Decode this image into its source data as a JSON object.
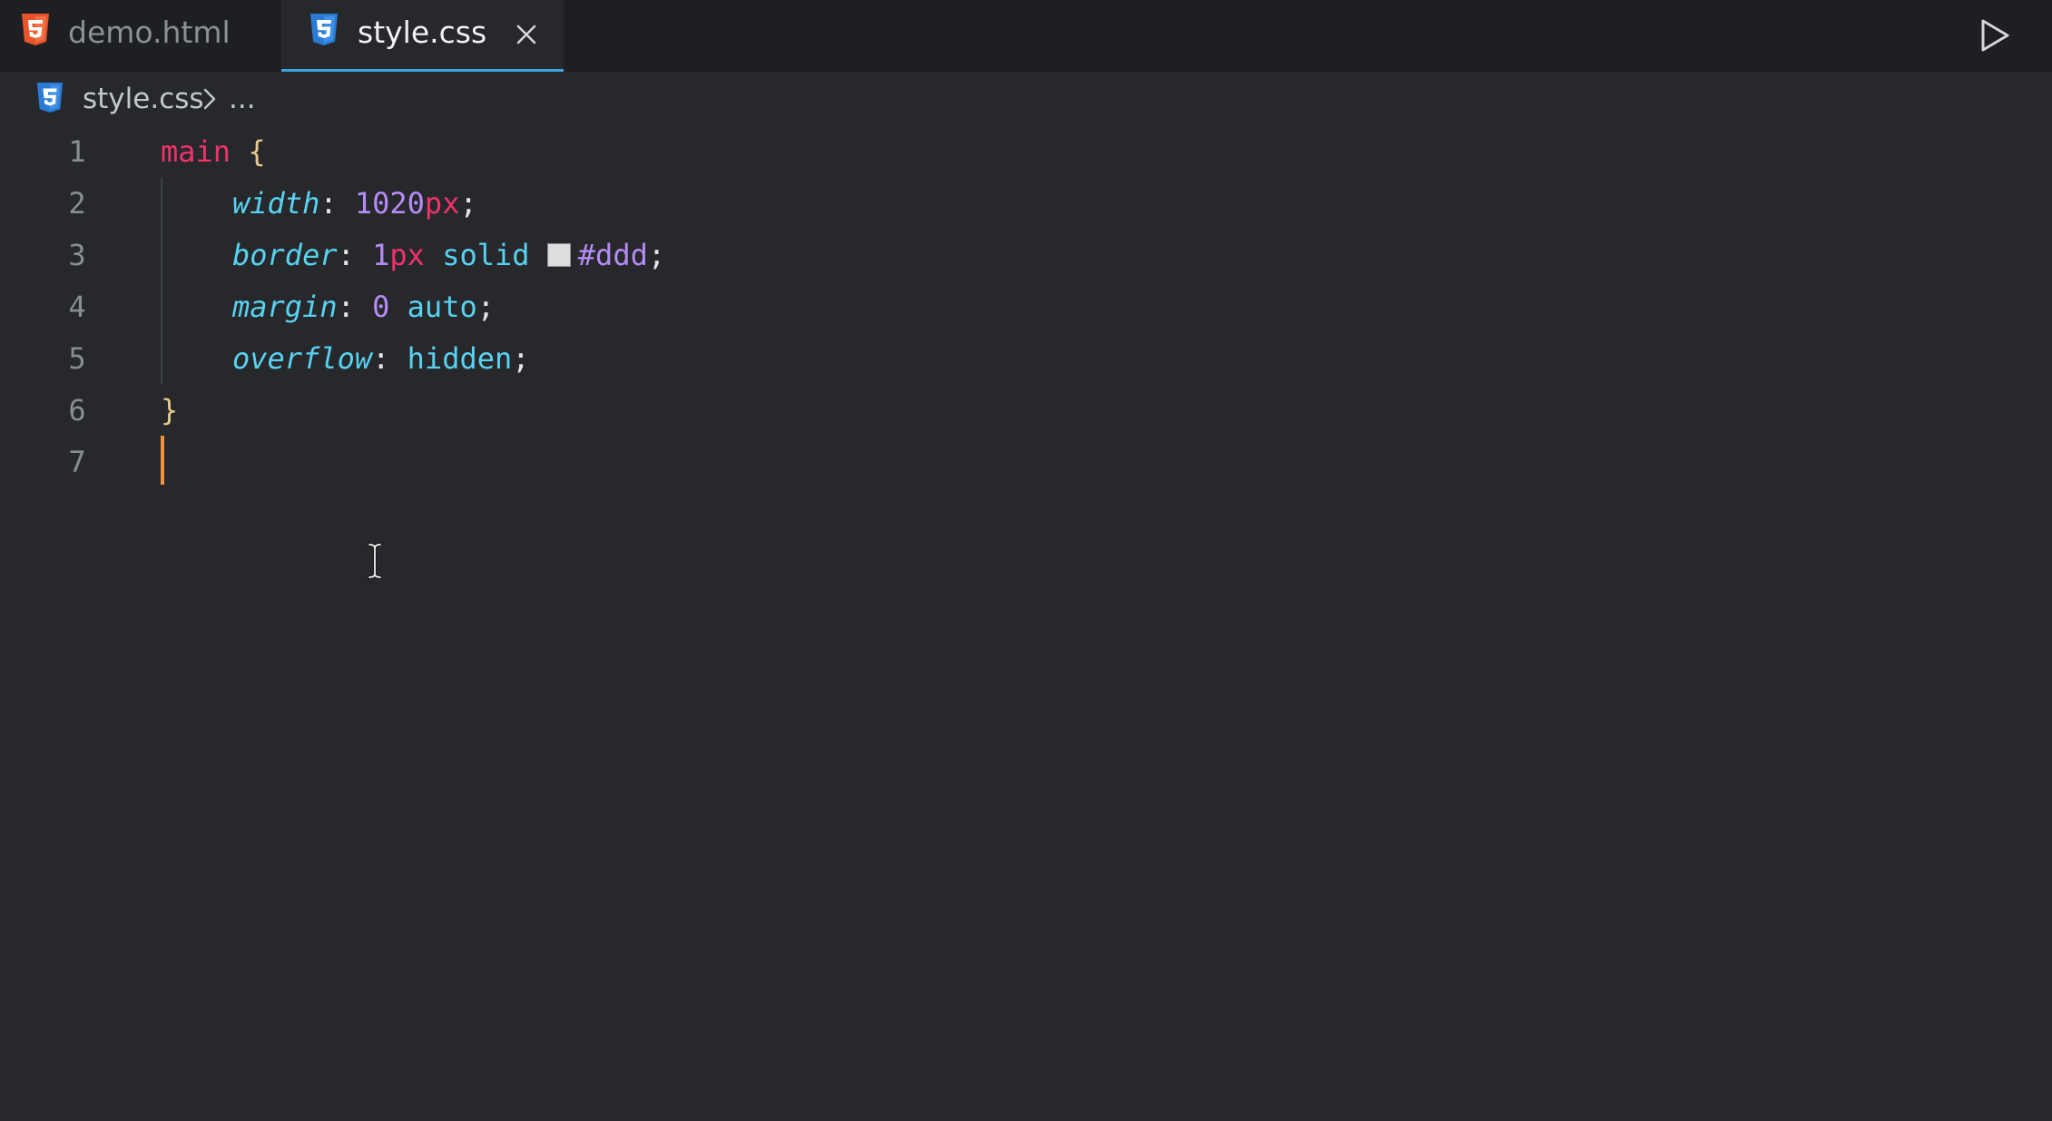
{
  "tabs": [
    {
      "label": "demo.html",
      "icon": "html5-icon",
      "active": false,
      "icon_color": "#e8552a"
    },
    {
      "label": "style.css",
      "icon": "css3-icon",
      "active": true,
      "icon_color": "#2a7bd4"
    }
  ],
  "breadcrumb": {
    "file": "style.css",
    "more": "..."
  },
  "editor": {
    "line_numbers": [
      "1",
      "2",
      "3",
      "4",
      "5",
      "6",
      "7"
    ],
    "lines": {
      "l1": {
        "selector": "main",
        "brace": "{"
      },
      "l2": {
        "prop": "width",
        "colon": ":",
        "num": "1020",
        "unit": "px",
        "semi": ";"
      },
      "l3": {
        "prop": "border",
        "colon": ":",
        "num": "1",
        "unit": "px",
        "kw": "solid",
        "hex": "#ddd",
        "semi": ";"
      },
      "l4": {
        "prop": "margin",
        "colon": ":",
        "num": "0",
        "kw": "auto",
        "semi": ";"
      },
      "l5": {
        "prop": "overflow",
        "colon": ":",
        "kw": "hidden",
        "semi": ";"
      },
      "l6": {
        "brace": "}"
      }
    },
    "color_swatch": "#dddddd",
    "cursor_line": 7,
    "cursor_color": "#f0923a"
  },
  "colors": {
    "accent_tab_underline": "#3aa8e0",
    "selector": "#f0336b",
    "property": "#59d2f0",
    "number": "#b58cf5"
  }
}
